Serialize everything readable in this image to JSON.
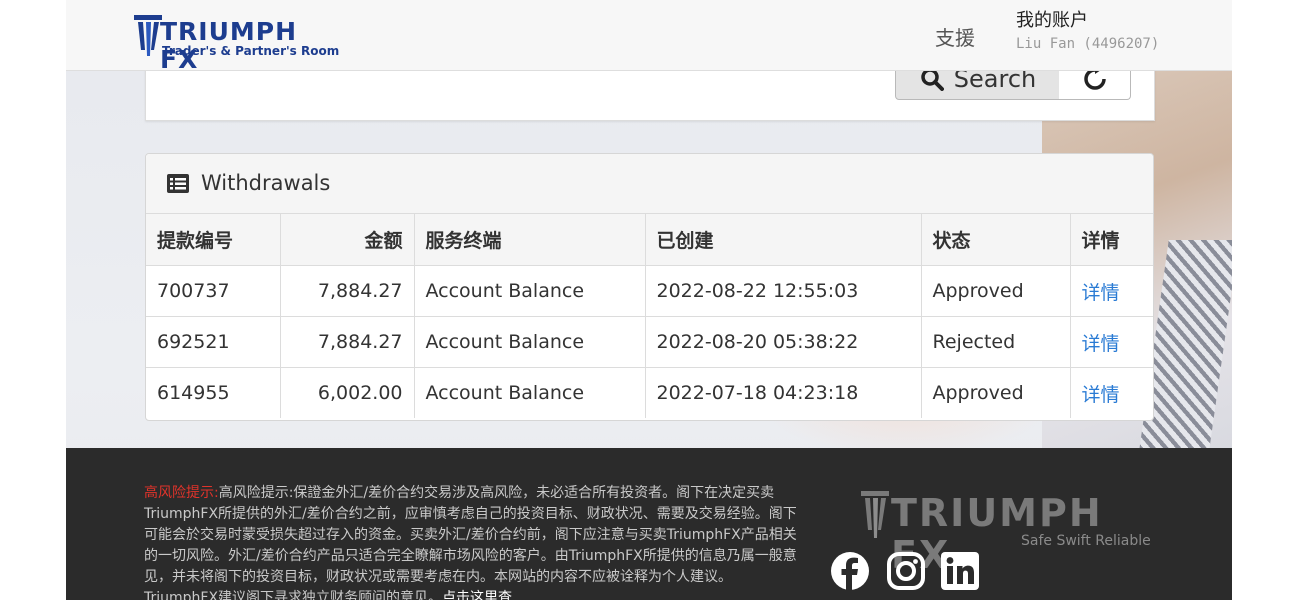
{
  "header": {
    "logo_title": "TRIUMPH FX",
    "logo_subtitle": "Trader's & Partner's Room",
    "support_label": "支援",
    "account_title": "我的账户",
    "account_user": "Liu Fan (4496207)"
  },
  "search": {
    "search_label": "Search"
  },
  "withdrawals": {
    "title": "Withdrawals",
    "columns": [
      "提款编号",
      "金额",
      "服务终端",
      "已创建",
      "状态",
      "详情"
    ],
    "rows": [
      {
        "id": "700737",
        "amount": "7,884.27",
        "terminal": "Account Balance",
        "created": "2022-08-22 12:55:03",
        "status": "Approved",
        "details": "详情"
      },
      {
        "id": "692521",
        "amount": "7,884.27",
        "terminal": "Account Balance",
        "created": "2022-08-20 05:38:22",
        "status": "Rejected",
        "details": "详情"
      },
      {
        "id": "614955",
        "amount": "6,002.00",
        "terminal": "Account Balance",
        "created": "2022-07-18 04:23:18",
        "status": "Approved",
        "details": "详情"
      }
    ]
  },
  "footer": {
    "risk_label": "高风险提示:",
    "risk_text": "高风险提示:保證金外汇/差价合约交易涉及高风险，未必适合所有投资者。阁下在决定买卖TriumphFX所提供的外汇/差价合约之前，应审慎考虑自己的投资目标、财政状况、需要及交易经验。阁下可能会於交易时蒙受损失超过存入的资金。买卖外汇/差价合约前，阁下应注意与买卖TriumphFX产品相关的一切风险。外汇/差价合约产品只适合完全瞭解市场风险的客户。由TriumphFX所提供的信息乃属一般意见，并未将阁下的投资目标，财政状况或需要考虑在内。本网站的内容不应被诠释为个人建议。TriumphFX建议阁下寻求独立财务顾问的意见。",
    "more_link": "点击这里查",
    "logo_text": "TRIUMPH FX",
    "tagline": "Safe Swift Reliable",
    "colors": {
      "background": "#2b2b2b",
      "warning": "#e0332b"
    }
  },
  "colors": {
    "brand": "#1d3d8f",
    "link": "#2a7bd4"
  },
  "icons": [
    "table-list-icon",
    "search-icon",
    "reset-icon",
    "facebook-icon",
    "instagram-icon",
    "linkedin-icon"
  ]
}
